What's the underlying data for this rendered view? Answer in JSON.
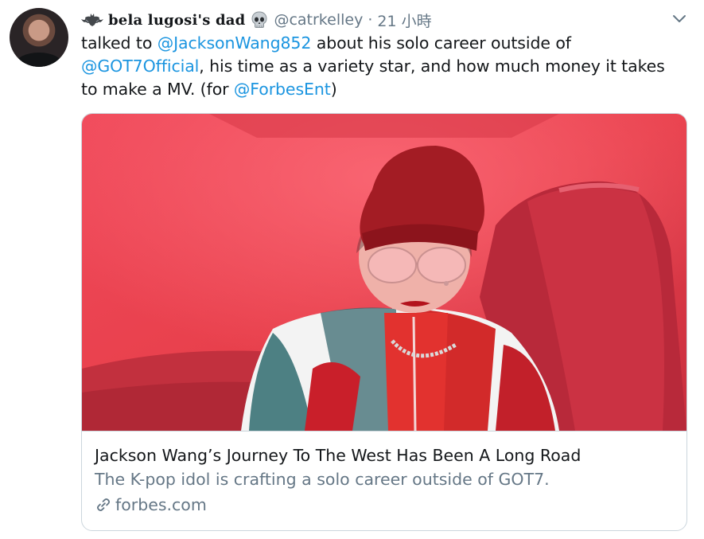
{
  "tweet": {
    "display_name": "bela lugosi's dad",
    "handle": "@catrkelley",
    "separator": "·",
    "time": "21 小時",
    "icons": {
      "prefix_emoji": "bat-icon",
      "suffix_emoji": "skull-icon",
      "menu": "chevron-down-icon",
      "avatar": "avatar"
    },
    "text": {
      "part1": "talked to ",
      "mention1": "@JacksonWang852",
      "part2": " about his solo career outside of ",
      "mention2": "@GOT7Official",
      "part3": ", his time as a variety star, and how much money it takes to make a MV. (for ",
      "mention3": "@ForbesEnt",
      "part4": ")"
    }
  },
  "card": {
    "title": "Jackson Wang’s Journey To The West Has Been A Long Road",
    "description": "The K-pop idol is crafting a solo career outside of GOT7.",
    "domain": "forbes.com",
    "domain_icon": "link-icon"
  },
  "colors": {
    "link": "#1b95e0",
    "secondary_text": "#657786",
    "border": "#ccd6dd",
    "photo_tint": "#e8404c"
  }
}
